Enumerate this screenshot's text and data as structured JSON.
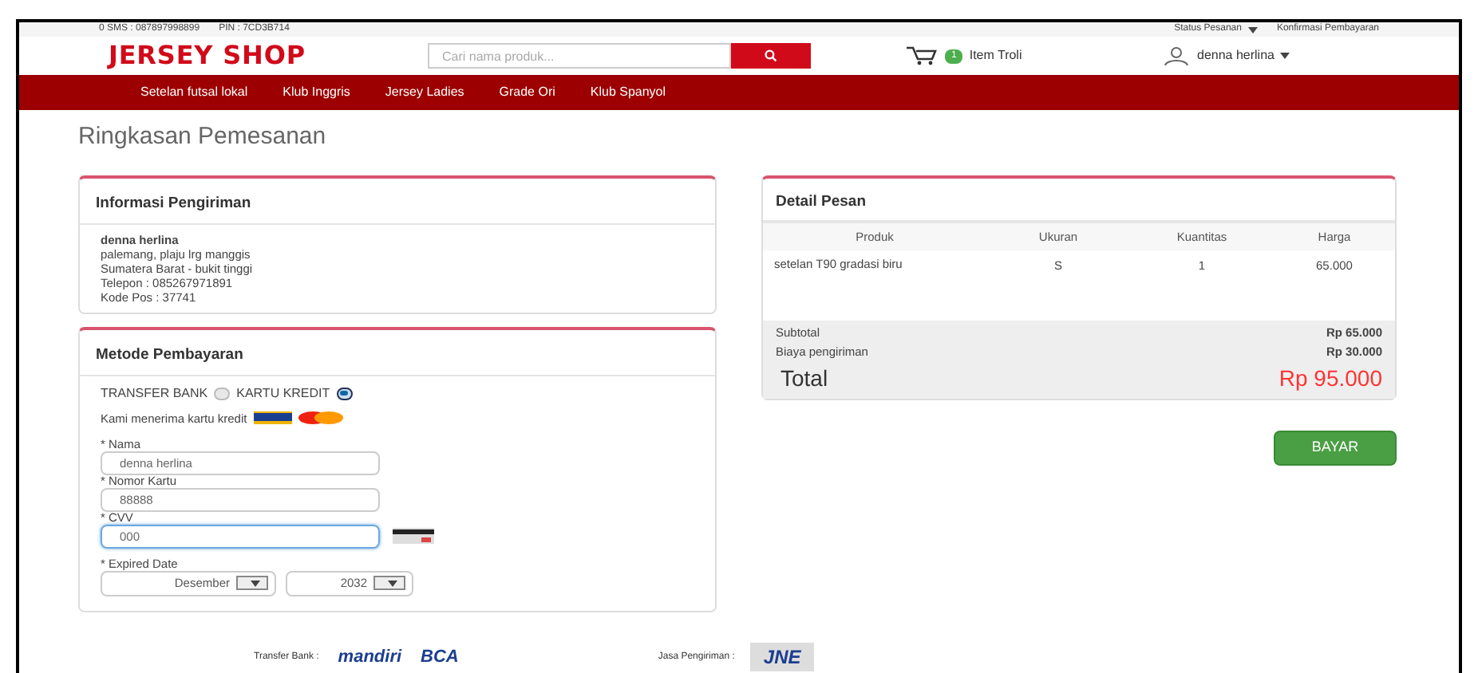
{
  "topbar": {
    "contact": [
      "0 SMS : 087897998899",
      "PIN : 7CD3B714"
    ],
    "links": [
      "Status Pesanan",
      "Konfirmasi Pembayaran"
    ]
  },
  "header": {
    "logo": "JERSEY SHOP",
    "search": {
      "placeholder": "Cari nama produk..."
    },
    "cart_count": "1",
    "cart_label": "Item Troli",
    "user": "denna herlina"
  },
  "nav": [
    "Setelan futsal lokal",
    "Klub Inggris",
    "Jersey Ladies",
    "Grade Ori",
    "Klub Spanyol"
  ],
  "page_title": "Ringkasan Pemesanan",
  "shipping": {
    "title": "Informasi Pengiriman",
    "name": "denna herlina",
    "lines": [
      "palemang, plaju lrg manggis",
      "Sumatera Barat - bukit tinggi",
      "Telepon : 085267971891",
      "Kode Pos : 37741"
    ]
  },
  "payment": {
    "title": "Metode Pembayaran",
    "options": [
      {
        "label": "TRANSFER BANK",
        "selected": false
      },
      {
        "label": "KARTU KREDIT",
        "selected": true
      }
    ],
    "accept_text": "Kami menerima kartu kredit",
    "fields": [
      {
        "label": "* Nama",
        "value": "denna herlina",
        "focused": false
      },
      {
        "label": "* Nomor Kartu",
        "value": "88888",
        "focused": false
      },
      {
        "label": "* CVV",
        "value": "000",
        "focused": true
      }
    ],
    "expiry_label": "* Expired Date",
    "month": "Desember",
    "year": "2032"
  },
  "order": {
    "title": "Detail Pesan",
    "columns": [
      "Produk",
      "Ukuran",
      "Kuantitas",
      "Harga"
    ],
    "rows": [
      [
        "setelan T90 gradasi biru",
        "S",
        "1",
        "65.000"
      ]
    ],
    "summary": [
      {
        "label": "Subtotal",
        "value": "Rp 65.000"
      },
      {
        "label": "Biaya pengiriman",
        "value": "Rp 30.000"
      }
    ],
    "total_label": "Total",
    "total_value": "Rp 95.000"
  },
  "pay_button": "BAYAR",
  "footer": {
    "bank_label": "Transfer Bank :",
    "banks": [
      "mandiri",
      "BCA"
    ],
    "courier_label": "Jasa Pengiriman :",
    "courier": "JNE"
  }
}
